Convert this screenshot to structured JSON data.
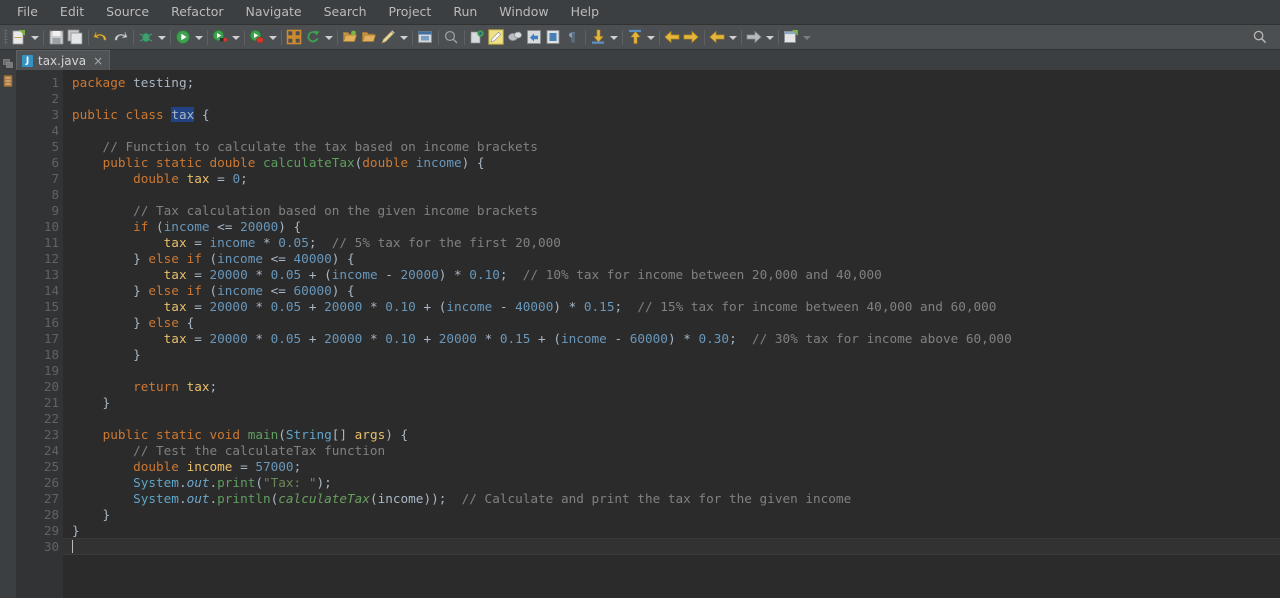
{
  "menubar": {
    "items": [
      {
        "label": "File"
      },
      {
        "label": "Edit"
      },
      {
        "label": "Source"
      },
      {
        "label": "Refactor"
      },
      {
        "label": "Navigate"
      },
      {
        "label": "Search"
      },
      {
        "label": "Project"
      },
      {
        "label": "Run"
      },
      {
        "label": "Window"
      },
      {
        "label": "Help"
      }
    ]
  },
  "toolbar": {
    "search_icon": "search-icon",
    "groups": [
      {
        "icons": [
          "new-file-icon"
        ],
        "dropdowns": [
          1
        ]
      },
      {
        "icons": [
          "save-icon",
          "save-all-icon"
        ]
      },
      {
        "icons": [
          "undo-icon",
          "redo-icon"
        ]
      },
      {
        "icons": [
          "debug-icon"
        ],
        "dropdowns": [
          1
        ]
      },
      {
        "icons": [
          "run-icon"
        ],
        "dropdowns": [
          1
        ]
      },
      {
        "icons": [
          "run-as-icon"
        ],
        "dropdowns": [
          1
        ]
      },
      {
        "icons": [
          "coverage-icon"
        ],
        "dropdowns": [
          1
        ]
      },
      {
        "icons": [
          "new-java-project-icon",
          "refresh-icon"
        ],
        "dropdowns": [
          1
        ]
      },
      {
        "icons": [
          "open-type-icon",
          "open-resource-icon",
          "edit-icon"
        ],
        "dropdowns": [
          1
        ]
      },
      {
        "icons": [
          "new-window-icon"
        ]
      },
      {
        "icons": [
          "search-file-icon"
        ]
      },
      {
        "icons": [
          "annotation-icon",
          "highlight-icon",
          "link-icon",
          "toggle-mark-icon",
          "book-icon",
          "paragraph-icon"
        ]
      },
      {
        "icons": [
          "next-annotation-icon"
        ],
        "dropdowns": [
          1
        ]
      },
      {
        "icons": [
          "previous-annotation-icon"
        ],
        "dropdowns": [
          1
        ]
      },
      {
        "icons": [
          "back-arrow-icon",
          "forward-arrow-icon"
        ]
      },
      {
        "icons": [
          "prev-edit-icon"
        ],
        "dropdowns": [
          1
        ]
      },
      {
        "icons": [
          "next-edit-icon"
        ],
        "dropdowns": [
          1
        ]
      },
      {
        "icons": [
          "open-perspective-icon"
        ]
      }
    ]
  },
  "sidebar": {
    "items": [
      {
        "name": "package-explorer-icon"
      },
      {
        "name": "outline-icon"
      }
    ]
  },
  "tabs": [
    {
      "label": "tax.java",
      "icon": "java-file-icon",
      "close": "×",
      "active": true
    }
  ],
  "editor": {
    "language": "java",
    "total_lines": 30,
    "caret_line": 30,
    "caret_column": 1,
    "selection_text": "tax",
    "change_bar": {
      "from_line": 3,
      "to_line": 29
    },
    "gutter_markers": [
      6,
      23
    ],
    "colors": {
      "background": "#2b2b2b",
      "gutter": "#313335",
      "line_number": "#606366",
      "keyword": "#cc7832",
      "comment": "#808080",
      "number": "#6897bb",
      "string": "#6a8759",
      "field": "#e8bf6a",
      "method": "#5f9e5f",
      "parameter": "#6897bb",
      "default_text": "#a9b7c6",
      "selection": "#214283",
      "change_bar": "#2d6b85",
      "current_line": "#323232"
    },
    "lines": [
      {
        "n": 1,
        "tokens": [
          {
            "t": "package ",
            "c": "kw"
          },
          {
            "t": "testing;",
            "c": "plain"
          }
        ]
      },
      {
        "n": 2,
        "tokens": []
      },
      {
        "n": 3,
        "tokens": [
          {
            "t": "public ",
            "c": "kw"
          },
          {
            "t": "class ",
            "c": "kw"
          },
          {
            "t": "tax",
            "c": "sel"
          },
          {
            "t": " {",
            "c": "plain"
          }
        ]
      },
      {
        "n": 4,
        "tokens": []
      },
      {
        "n": 5,
        "tokens": [
          {
            "t": "    // Function to calculate the tax based on income brackets",
            "c": "cm"
          }
        ]
      },
      {
        "n": 6,
        "tokens": [
          {
            "t": "    ",
            "c": "plain"
          },
          {
            "t": "public static double ",
            "c": "kw"
          },
          {
            "t": "calculateTax",
            "c": "mth"
          },
          {
            "t": "(",
            "c": "plain"
          },
          {
            "t": "double ",
            "c": "kw"
          },
          {
            "t": "income",
            "c": "param"
          },
          {
            "t": ") {",
            "c": "plain"
          }
        ]
      },
      {
        "n": 7,
        "tokens": [
          {
            "t": "        ",
            "c": "plain"
          },
          {
            "t": "double ",
            "c": "kw"
          },
          {
            "t": "tax",
            "c": "decl"
          },
          {
            "t": " = ",
            "c": "plain"
          },
          {
            "t": "0",
            "c": "num"
          },
          {
            "t": ";",
            "c": "plain"
          }
        ]
      },
      {
        "n": 8,
        "tokens": []
      },
      {
        "n": 9,
        "tokens": [
          {
            "t": "        // Tax calculation based on the given income brackets",
            "c": "cm"
          }
        ]
      },
      {
        "n": 10,
        "tokens": [
          {
            "t": "        ",
            "c": "plain"
          },
          {
            "t": "if ",
            "c": "kw"
          },
          {
            "t": "(",
            "c": "plain"
          },
          {
            "t": "income",
            "c": "param"
          },
          {
            "t": " <= ",
            "c": "plain"
          },
          {
            "t": "20000",
            "c": "num"
          },
          {
            "t": ") {",
            "c": "plain"
          }
        ]
      },
      {
        "n": 11,
        "tokens": [
          {
            "t": "            ",
            "c": "plain"
          },
          {
            "t": "tax",
            "c": "fld"
          },
          {
            "t": " = ",
            "c": "plain"
          },
          {
            "t": "income",
            "c": "param"
          },
          {
            "t": " * ",
            "c": "plain"
          },
          {
            "t": "0.05",
            "c": "num"
          },
          {
            "t": ";  ",
            "c": "plain"
          },
          {
            "t": "// 5% tax for the first 20,000",
            "c": "cm"
          }
        ]
      },
      {
        "n": 12,
        "tokens": [
          {
            "t": "        } ",
            "c": "plain"
          },
          {
            "t": "else if ",
            "c": "kw"
          },
          {
            "t": "(",
            "c": "plain"
          },
          {
            "t": "income",
            "c": "param"
          },
          {
            "t": " <= ",
            "c": "plain"
          },
          {
            "t": "40000",
            "c": "num"
          },
          {
            "t": ") {",
            "c": "plain"
          }
        ]
      },
      {
        "n": 13,
        "tokens": [
          {
            "t": "            ",
            "c": "plain"
          },
          {
            "t": "tax",
            "c": "fld"
          },
          {
            "t": " = ",
            "c": "plain"
          },
          {
            "t": "20000",
            "c": "num"
          },
          {
            "t": " * ",
            "c": "plain"
          },
          {
            "t": "0.05",
            "c": "num"
          },
          {
            "t": " + (",
            "c": "plain"
          },
          {
            "t": "income",
            "c": "param"
          },
          {
            "t": " - ",
            "c": "plain"
          },
          {
            "t": "20000",
            "c": "num"
          },
          {
            "t": ") * ",
            "c": "plain"
          },
          {
            "t": "0.10",
            "c": "num"
          },
          {
            "t": ";  ",
            "c": "plain"
          },
          {
            "t": "// 10% tax for income between 20,000 and 40,000",
            "c": "cm"
          }
        ]
      },
      {
        "n": 14,
        "tokens": [
          {
            "t": "        } ",
            "c": "plain"
          },
          {
            "t": "else if ",
            "c": "kw"
          },
          {
            "t": "(",
            "c": "plain"
          },
          {
            "t": "income",
            "c": "param"
          },
          {
            "t": " <= ",
            "c": "plain"
          },
          {
            "t": "60000",
            "c": "num"
          },
          {
            "t": ") {",
            "c": "plain"
          }
        ]
      },
      {
        "n": 15,
        "tokens": [
          {
            "t": "            ",
            "c": "plain"
          },
          {
            "t": "tax",
            "c": "fld"
          },
          {
            "t": " = ",
            "c": "plain"
          },
          {
            "t": "20000",
            "c": "num"
          },
          {
            "t": " * ",
            "c": "plain"
          },
          {
            "t": "0.05",
            "c": "num"
          },
          {
            "t": " + ",
            "c": "plain"
          },
          {
            "t": "20000",
            "c": "num"
          },
          {
            "t": " * ",
            "c": "plain"
          },
          {
            "t": "0.10",
            "c": "num"
          },
          {
            "t": " + (",
            "c": "plain"
          },
          {
            "t": "income",
            "c": "param"
          },
          {
            "t": " - ",
            "c": "plain"
          },
          {
            "t": "40000",
            "c": "num"
          },
          {
            "t": ") * ",
            "c": "plain"
          },
          {
            "t": "0.15",
            "c": "num"
          },
          {
            "t": ";  ",
            "c": "plain"
          },
          {
            "t": "// 15% tax for income between 40,000 and 60,000",
            "c": "cm"
          }
        ]
      },
      {
        "n": 16,
        "tokens": [
          {
            "t": "        } ",
            "c": "plain"
          },
          {
            "t": "else ",
            "c": "kw"
          },
          {
            "t": "{",
            "c": "plain"
          }
        ]
      },
      {
        "n": 17,
        "tokens": [
          {
            "t": "            ",
            "c": "plain"
          },
          {
            "t": "tax",
            "c": "fld"
          },
          {
            "t": " = ",
            "c": "plain"
          },
          {
            "t": "20000",
            "c": "num"
          },
          {
            "t": " * ",
            "c": "plain"
          },
          {
            "t": "0.05",
            "c": "num"
          },
          {
            "t": " + ",
            "c": "plain"
          },
          {
            "t": "20000",
            "c": "num"
          },
          {
            "t": " * ",
            "c": "plain"
          },
          {
            "t": "0.10",
            "c": "num"
          },
          {
            "t": " + ",
            "c": "plain"
          },
          {
            "t": "20000",
            "c": "num"
          },
          {
            "t": " * ",
            "c": "plain"
          },
          {
            "t": "0.15",
            "c": "num"
          },
          {
            "t": " + (",
            "c": "plain"
          },
          {
            "t": "income",
            "c": "param"
          },
          {
            "t": " - ",
            "c": "plain"
          },
          {
            "t": "60000",
            "c": "num"
          },
          {
            "t": ") * ",
            "c": "plain"
          },
          {
            "t": "0.30",
            "c": "num"
          },
          {
            "t": ";  ",
            "c": "plain"
          },
          {
            "t": "// 30% tax for income above 60,000",
            "c": "cm"
          }
        ]
      },
      {
        "n": 18,
        "tokens": [
          {
            "t": "        }",
            "c": "plain"
          }
        ]
      },
      {
        "n": 19,
        "tokens": []
      },
      {
        "n": 20,
        "tokens": [
          {
            "t": "        ",
            "c": "plain"
          },
          {
            "t": "return ",
            "c": "kw"
          },
          {
            "t": "tax",
            "c": "fld"
          },
          {
            "t": ";",
            "c": "plain"
          }
        ]
      },
      {
        "n": 21,
        "tokens": [
          {
            "t": "    }",
            "c": "plain"
          }
        ]
      },
      {
        "n": 22,
        "tokens": []
      },
      {
        "n": 23,
        "tokens": [
          {
            "t": "    ",
            "c": "plain"
          },
          {
            "t": "public static void ",
            "c": "kw"
          },
          {
            "t": "main",
            "c": "mth"
          },
          {
            "t": "(",
            "c": "plain"
          },
          {
            "t": "String",
            "c": "sys"
          },
          {
            "t": "[] ",
            "c": "plain"
          },
          {
            "t": "args",
            "c": "fld"
          },
          {
            "t": ") {",
            "c": "plain"
          }
        ]
      },
      {
        "n": 24,
        "tokens": [
          {
            "t": "        // Test the calculateTax function",
            "c": "cm"
          }
        ]
      },
      {
        "n": 25,
        "tokens": [
          {
            "t": "        ",
            "c": "plain"
          },
          {
            "t": "double ",
            "c": "kw"
          },
          {
            "t": "income",
            "c": "decl"
          },
          {
            "t": " = ",
            "c": "plain"
          },
          {
            "t": "57000",
            "c": "num"
          },
          {
            "t": ";",
            "c": "plain"
          }
        ]
      },
      {
        "n": 26,
        "tokens": [
          {
            "t": "        ",
            "c": "plain"
          },
          {
            "t": "System",
            "c": "sys"
          },
          {
            "t": ".",
            "c": "plain"
          },
          {
            "t": "out",
            "c": "statfld"
          },
          {
            "t": ".",
            "c": "plain"
          },
          {
            "t": "print",
            "c": "mth"
          },
          {
            "t": "(",
            "c": "plain"
          },
          {
            "t": "\"Tax: \"",
            "c": "str"
          },
          {
            "t": ");",
            "c": "plain"
          }
        ]
      },
      {
        "n": 27,
        "tokens": [
          {
            "t": "        ",
            "c": "plain"
          },
          {
            "t": "System",
            "c": "sys"
          },
          {
            "t": ".",
            "c": "plain"
          },
          {
            "t": "out",
            "c": "statfld"
          },
          {
            "t": ".",
            "c": "plain"
          },
          {
            "t": "println",
            "c": "mth"
          },
          {
            "t": "(",
            "c": "plain"
          },
          {
            "t": "calculateTax",
            "c": "italfn"
          },
          {
            "t": "(",
            "c": "plain"
          },
          {
            "t": "income",
            "c": "lvar"
          },
          {
            "t": "));  ",
            "c": "plain"
          },
          {
            "t": "// Calculate and print the tax for the given income",
            "c": "cm"
          }
        ]
      },
      {
        "n": 28,
        "tokens": [
          {
            "t": "    }",
            "c": "plain"
          }
        ]
      },
      {
        "n": 29,
        "tokens": [
          {
            "t": "}",
            "c": "plain"
          }
        ]
      },
      {
        "n": 30,
        "tokens": [],
        "caret": true
      }
    ]
  }
}
